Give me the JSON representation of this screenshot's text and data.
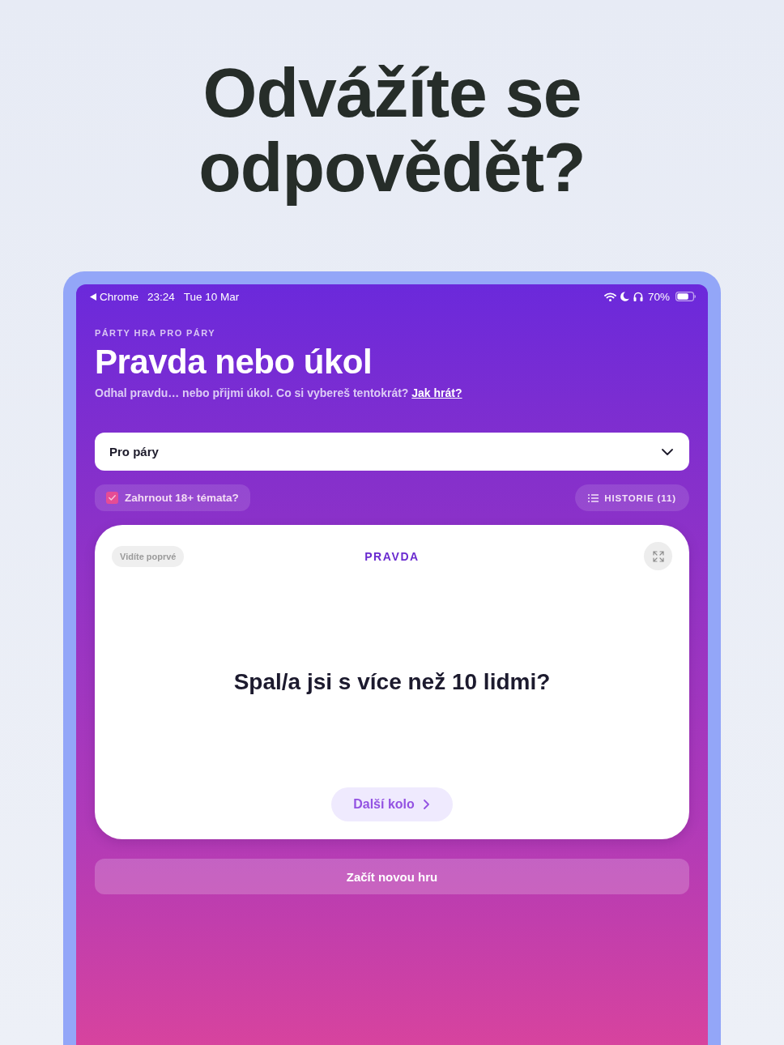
{
  "headline": "Odvážíte se odpovědět?",
  "status_bar": {
    "back_app": "Chrome",
    "time": "23:24",
    "date": "Tue 10 Mar",
    "battery": "70%"
  },
  "header": {
    "eyebrow": "PÁRTY HRA PRO PÁRY",
    "title": "Pravda nebo úkol",
    "subtitle": "Odhal pravdu… nebo přijmi úkol. Co si vybereš tentokrát?",
    "help_link": "Jak hrát?"
  },
  "mode_select": {
    "value": "Pro páry"
  },
  "adult_topics": {
    "label": "Zahrnout 18+ témata?",
    "checked": true
  },
  "history_button": {
    "label": "HISTORIE (11)"
  },
  "card": {
    "badge": "Vidíte poprvé",
    "type_label": "PRAVDA",
    "question": "Spal/a jsi s více než 10 lidmi?",
    "next_button": "Další kolo"
  },
  "new_game_button": "Začít novou hru"
}
